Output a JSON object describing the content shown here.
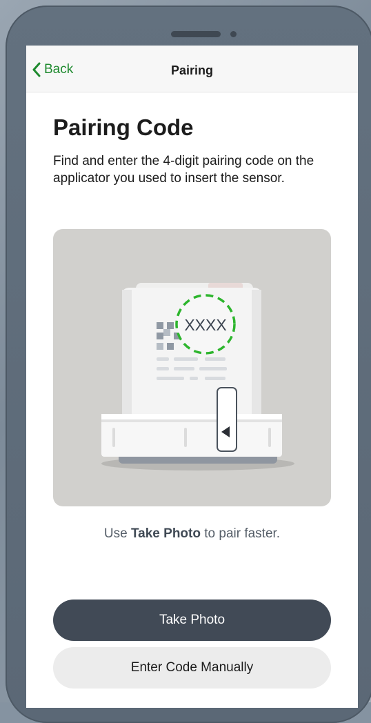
{
  "nav": {
    "back_label": "Back",
    "title": "Pairing"
  },
  "main": {
    "heading": "Pairing Code",
    "description": "Find and enter the 4-digit pairing code on the applicator you used to insert the sensor.",
    "illustration": {
      "code_placeholder": "XXXX"
    },
    "hint": {
      "prefix": "Use ",
      "emphasis": "Take Photo",
      "suffix": " to pair faster."
    }
  },
  "buttons": {
    "take_photo": "Take Photo",
    "enter_manually": "Enter Code Manually"
  },
  "colors": {
    "accent_green": "#1e8a2e",
    "primary_button": "#414a56",
    "secondary_button": "#ececec",
    "code_circle": "#2db52d"
  }
}
